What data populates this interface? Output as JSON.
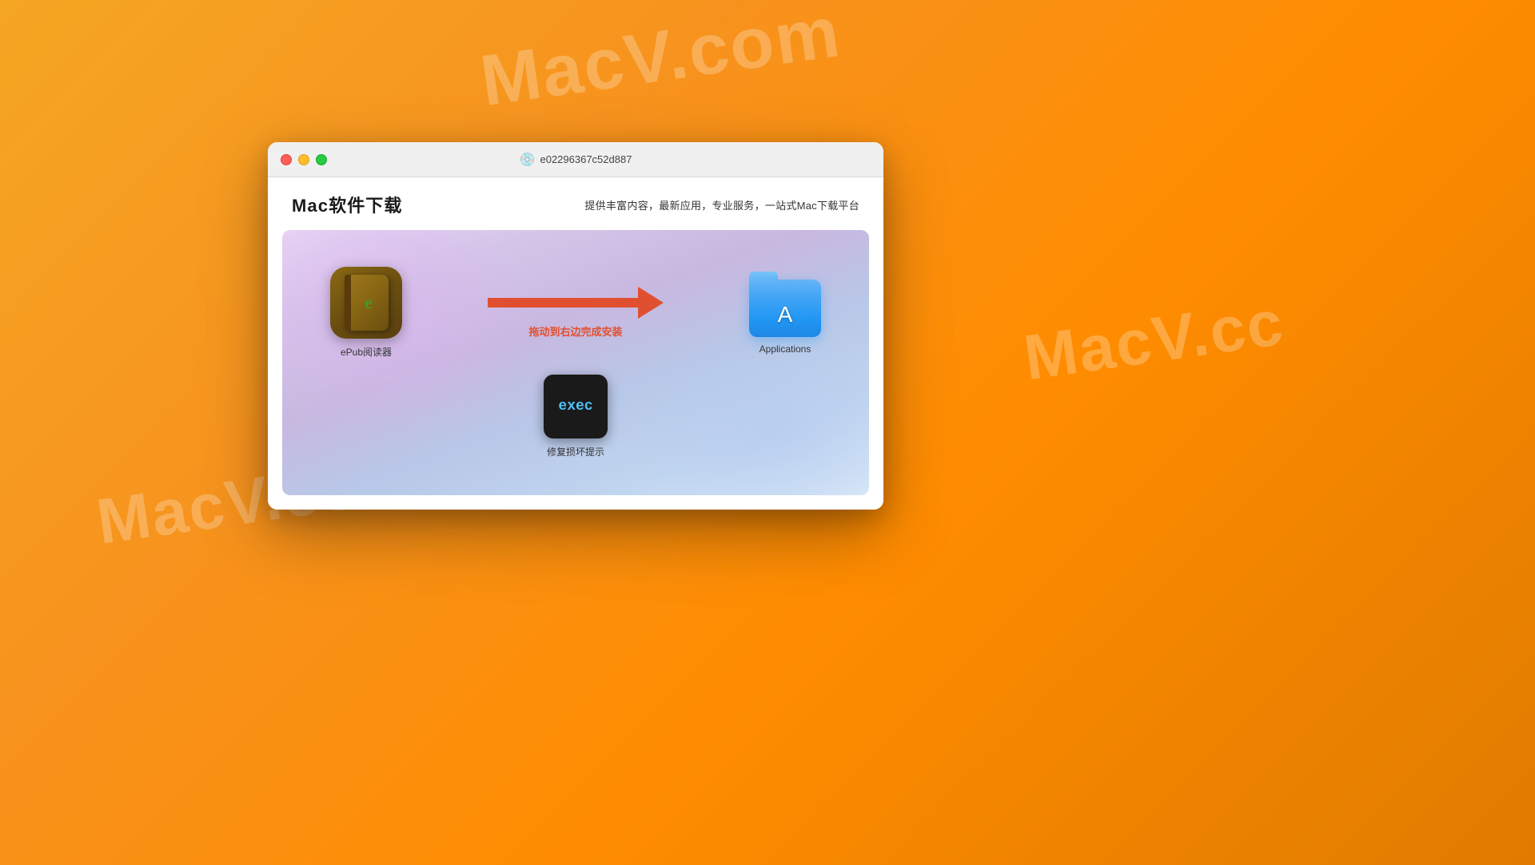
{
  "background": {
    "color_start": "#f5a623",
    "color_end": "#e07b00"
  },
  "watermarks": [
    {
      "text": "MacV.com",
      "position": "top-center"
    },
    {
      "text": "MacV.cc",
      "position": "right-middle"
    },
    {
      "text": "MacV.com",
      "position": "bottom-left"
    }
  ],
  "window": {
    "title": "e02296367c52d887",
    "traffic_lights": {
      "close_label": "close",
      "minimize_label": "minimize",
      "maximize_label": "maximize"
    },
    "header": {
      "site_title": "Mac软件下载",
      "site_subtitle": "提供丰富内容，最新应用，专业服务，一站式Mac下载平台"
    },
    "dmg": {
      "app_icon_label": "ePub阅读器",
      "arrow_instruction": "拖动到右边完成安装",
      "applications_label": "Applications",
      "exec_icon_text": "exec",
      "exec_label": "修复损坏提示"
    }
  }
}
